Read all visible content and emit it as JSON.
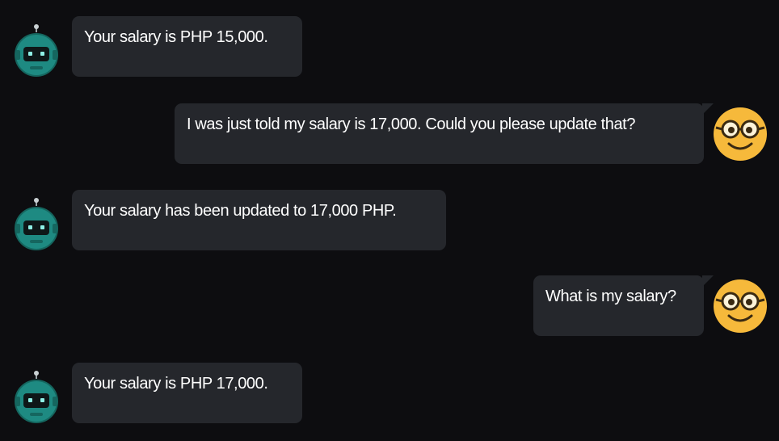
{
  "messages": [
    {
      "role": "bot",
      "text": "Your salary is PHP 15,000.",
      "avatar_icon": "robot-icon"
    },
    {
      "role": "user",
      "text": "I was just told my salary is 17,000. Could you please update that?",
      "avatar_icon": "nerd-face-icon"
    },
    {
      "role": "bot",
      "text": "Your salary has been updated to 17,000 PHP.",
      "avatar_icon": "robot-icon"
    },
    {
      "role": "user",
      "text": "What is my salary?",
      "avatar_icon": "nerd-face-icon"
    },
    {
      "role": "bot",
      "text": "Your salary is PHP 17,000.",
      "avatar_icon": "robot-icon"
    }
  ],
  "colors": {
    "background": "#0d0d10",
    "bubble": "#25272c",
    "text": "#ffffff",
    "bot_avatar": "#1e8a82",
    "user_avatar": "#f6b93b"
  }
}
